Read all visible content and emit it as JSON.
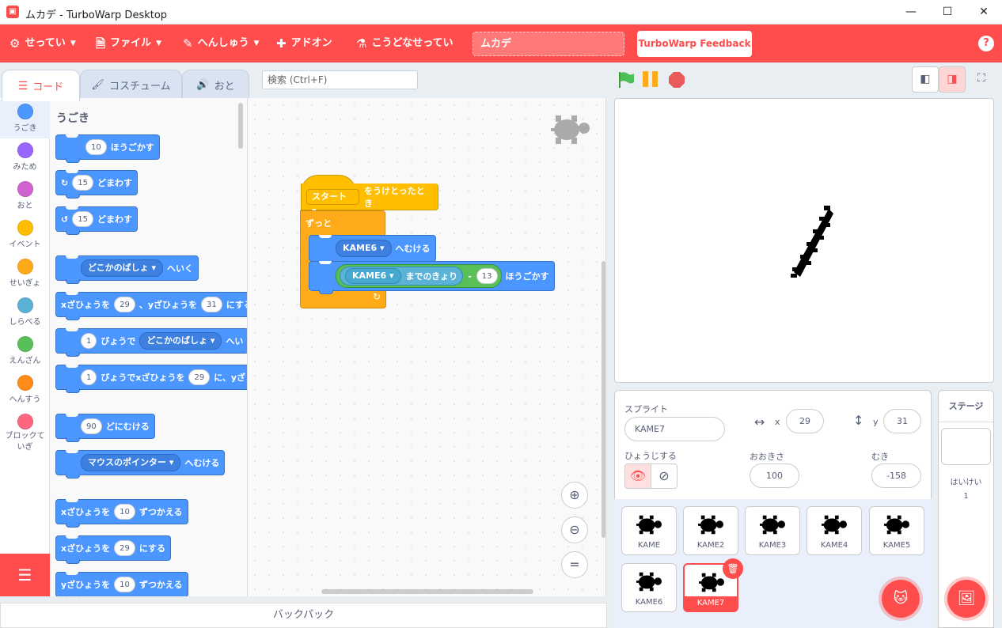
{
  "window": {
    "title": "ムカデ - TurboWarp Desktop"
  },
  "menu": {
    "settings": "せってい",
    "file": "ファイル",
    "edit": "へんしゅう",
    "addons": "アドオン",
    "advanced": "こうどなせってい",
    "project_title": "ムカデ",
    "feedback": "TurboWarp Feedback",
    "help": "?"
  },
  "tabs": {
    "code": "コード",
    "costume": "コスチューム",
    "sound": "おと"
  },
  "search": {
    "placeholder": "検索 (Ctrl+F)"
  },
  "categories": [
    {
      "label": "うごき",
      "color": "#4c97ff"
    },
    {
      "label": "みため",
      "color": "#9966ff"
    },
    {
      "label": "おと",
      "color": "#cf63cf"
    },
    {
      "label": "イベント",
      "color": "#ffbf00"
    },
    {
      "label": "せいぎょ",
      "color": "#ffab19"
    },
    {
      "label": "しらべる",
      "color": "#5cb1d6"
    },
    {
      "label": "えんざん",
      "color": "#59c059"
    },
    {
      "label": "へんすう",
      "color": "#ff8c1a"
    },
    {
      "label": "ブロックていぎ",
      "color": "#ff6680"
    }
  ],
  "palette": {
    "heading": "うごき",
    "b1": {
      "n": "10",
      "t": "ほうごかす"
    },
    "b2": {
      "n": "15",
      "t": "どまわす"
    },
    "b3": {
      "n": "15",
      "t": "どまわす"
    },
    "b4": {
      "d": "どこかのばしょ",
      "t": "へいく"
    },
    "b5": {
      "a": "xざひょうを",
      "n1": "29",
      "b": "、yざひょうを",
      "n2": "31",
      "c": "にする"
    },
    "b6": {
      "n": "1",
      "a": "びょうで",
      "d": "どこかのばしょ",
      "t": "へい"
    },
    "b7": {
      "n": "1",
      "a": "びょうでxざひょうを",
      "n2": "29",
      "t": "に、yざ"
    },
    "b8": {
      "n": "90",
      "t": "どにむける"
    },
    "b9": {
      "d": "マウスのポインター",
      "t": "へむける"
    },
    "b10": {
      "a": "xざひょうを",
      "n": "10",
      "t": "ずつかえる"
    },
    "b11": {
      "a": "xざひょうを",
      "n": "29",
      "t": "にする"
    },
    "b12": {
      "a": "yざひょうを",
      "n": "10",
      "t": "ずつかえる"
    }
  },
  "script": {
    "hat_dropdown": "スタート",
    "hat_text": "をうけとったとき",
    "forever": "ずっと",
    "point_dropdown": "KAME6",
    "point_text": "へむける",
    "dist_dropdown": "KAME6",
    "dist_text": "までのきょり",
    "minus": "-",
    "dist_num": "13",
    "move_text": "ほうごかす"
  },
  "backpack": "バックパック",
  "sprite": {
    "label": "スプライト",
    "name": "KAME7",
    "x_label": "x",
    "x": "29",
    "y_label": "y",
    "y": "31",
    "show_label": "ひょうじする",
    "size_label": "おおきさ",
    "size": "100",
    "dir_label": "むき",
    "direction": "-158"
  },
  "sprites": [
    "KAME",
    "KAME2",
    "KAME3",
    "KAME4",
    "KAME5",
    "KAME6",
    "KAME7"
  ],
  "stage_panel": {
    "title": "ステージ",
    "backdrops_label": "はいけい",
    "backdrops_count": "1"
  },
  "colors": {
    "accent": "#ff4c4c",
    "motion": "#4c97ff",
    "events": "#ffbf00",
    "control": "#ffab19",
    "operators": "#59c059"
  }
}
